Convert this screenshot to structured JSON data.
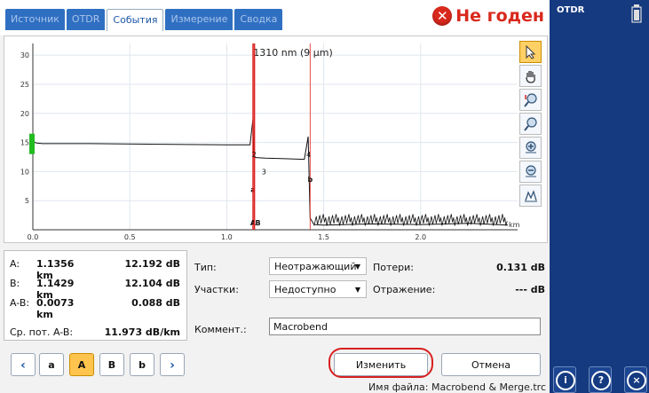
{
  "tabs": [
    {
      "label": "Источник",
      "active": false
    },
    {
      "label": "OTDR",
      "active": false
    },
    {
      "label": "События",
      "active": true
    },
    {
      "label": "Измерение",
      "active": false
    },
    {
      "label": "Сводка",
      "active": false
    }
  ],
  "status": {
    "text": "Не годен",
    "icon": "fail-x-icon",
    "color": "#d9281c"
  },
  "chart_data": {
    "type": "line",
    "title": "1310 nm (9 μm)",
    "xlabel": "km",
    "xlim": [
      0,
      2.5
    ],
    "ylim": [
      0,
      32
    ],
    "x_ticks": [
      "0.0",
      "0.5",
      "1.0",
      "1.5",
      "2.0"
    ],
    "y_ticks": [
      "5",
      "10",
      "15",
      "20",
      "25",
      "30"
    ],
    "series": [
      {
        "x": [
          0.0,
          0.01,
          0.02,
          0.05,
          0.3,
          0.6,
          1.0,
          1.12,
          1.135,
          1.14,
          1.145,
          1.15,
          1.2,
          1.3,
          1.4,
          1.42,
          1.43,
          1.45,
          1.5,
          1.75,
          2.0,
          2.25,
          2.45
        ],
        "y": [
          15.5,
          15.0,
          14.9,
          14.8,
          14.8,
          14.7,
          14.6,
          14.6,
          19.0,
          12.5,
          12.4,
          12.4,
          12.3,
          12.2,
          12.1,
          16.0,
          2.0,
          0.9,
          0.8,
          1.0,
          0.9,
          1.1,
          0.8
        ]
      }
    ],
    "markers": [
      {
        "label": "a",
        "x": 1.1356
      },
      {
        "label": "A",
        "x": 1.1356
      },
      {
        "label": "B",
        "x": 1.1429
      },
      {
        "label": "b",
        "x": 1.43
      }
    ],
    "event_labels": [
      "2",
      "3",
      "4"
    ],
    "grid": true
  },
  "tools": [
    {
      "name": "pointer-icon",
      "active": true
    },
    {
      "name": "pan-hand-icon",
      "active": false
    },
    {
      "name": "zoom-markers-icon",
      "active": false
    },
    {
      "name": "zoom-fit-icon",
      "active": false
    },
    {
      "name": "zoom-in-icon",
      "active": false
    },
    {
      "name": "zoom-out-icon",
      "active": false
    },
    {
      "name": "zoom-full-icon",
      "active": false
    }
  ],
  "info": {
    "a_label": "A:",
    "a_dist": "1.1356 km",
    "a_db": "12.192 dB",
    "b_label": "B:",
    "b_dist": "1.1429 km",
    "b_db": "12.104 dB",
    "ab_label": "A-B:",
    "ab_dist": "0.0073 km",
    "ab_db": "0.088 dB",
    "avg_label": "Ср. пот. A-B:",
    "avg_val": "11.973 dB/km"
  },
  "form": {
    "type_label": "Тип:",
    "type_value": "Неотражающий",
    "sections_label": "Участки:",
    "sections_value": "Недоступно",
    "loss_label": "Потери:",
    "loss_value": "0.131 dB",
    "reflect_label": "Отражение:",
    "reflect_value": "--- dB",
    "comment_label": "Коммент.:",
    "comment_value": "Macrobend"
  },
  "nav": {
    "prev": "‹",
    "a": "a",
    "A": "A",
    "B": "B",
    "b": "b",
    "next": "›"
  },
  "buttons": {
    "modify": "Изменить",
    "cancel": "Отмена"
  },
  "filename": "Имя файла: Macrobend & Merge.trc",
  "side": {
    "title": "OTDR",
    "info": "i",
    "help": "?",
    "close": "×"
  }
}
